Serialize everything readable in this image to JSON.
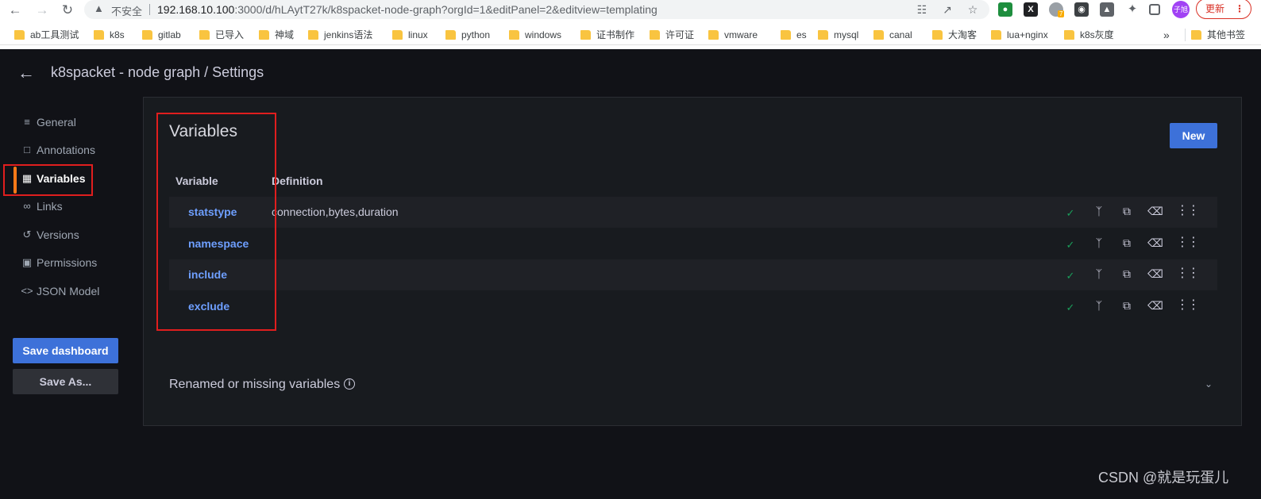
{
  "browser": {
    "insecure_label": "不安全",
    "url_host": "192.168.10.100",
    "url_rest": ":3000/d/hLAytT27k/k8spacket-node-graph?orgId=1&editPanel=2&editview=templating",
    "avatar_text": "子旭",
    "update_label": "更新",
    "ext_badge": "7",
    "bookmarks": [
      "ab工具测试",
      "k8s",
      "gitlab",
      "已导入",
      "神域",
      "jenkins语法",
      "linux",
      "python",
      "windows",
      "证书制作",
      "许可证",
      "vmware",
      "es",
      "mysql",
      "canal",
      "大淘客",
      "lua+nginx",
      "k8s灰度"
    ],
    "bookmarks_more": "»",
    "other_bookmarks": "其他书签"
  },
  "app": {
    "title": "k8spacket - node graph / Settings",
    "nav": [
      {
        "label": "General",
        "icon": "sliders-icon"
      },
      {
        "label": "Annotations",
        "icon": "comment-icon"
      },
      {
        "label": "Variables",
        "icon": "calculator-icon",
        "active": true
      },
      {
        "label": "Links",
        "icon": "link-icon"
      },
      {
        "label": "Versions",
        "icon": "history-icon"
      },
      {
        "label": "Permissions",
        "icon": "lock-icon"
      },
      {
        "label": "JSON Model",
        "icon": "code-icon"
      }
    ],
    "save_dashboard": "Save dashboard",
    "save_as": "Save As..."
  },
  "variables": {
    "heading": "Variables",
    "new_button": "New",
    "col_variable": "Variable",
    "col_definition": "Definition",
    "rows": [
      {
        "name": "statstype",
        "definition": "connection,bytes,duration"
      },
      {
        "name": "namespace",
        "definition": ""
      },
      {
        "name": "include",
        "definition": ""
      },
      {
        "name": "exclude",
        "definition": ""
      }
    ],
    "renamed_label": "Renamed or missing variables"
  },
  "watermark": "CSDN @就是玩蛋儿",
  "colors": {
    "accent_blue": "#3d71d9",
    "variable_link": "#6e9fff",
    "active_bar": "#ff7a18",
    "highlight_red": "#e01e1e",
    "check_green": "#1a9e5a",
    "background": "#111217",
    "panel": "#181b1f"
  }
}
